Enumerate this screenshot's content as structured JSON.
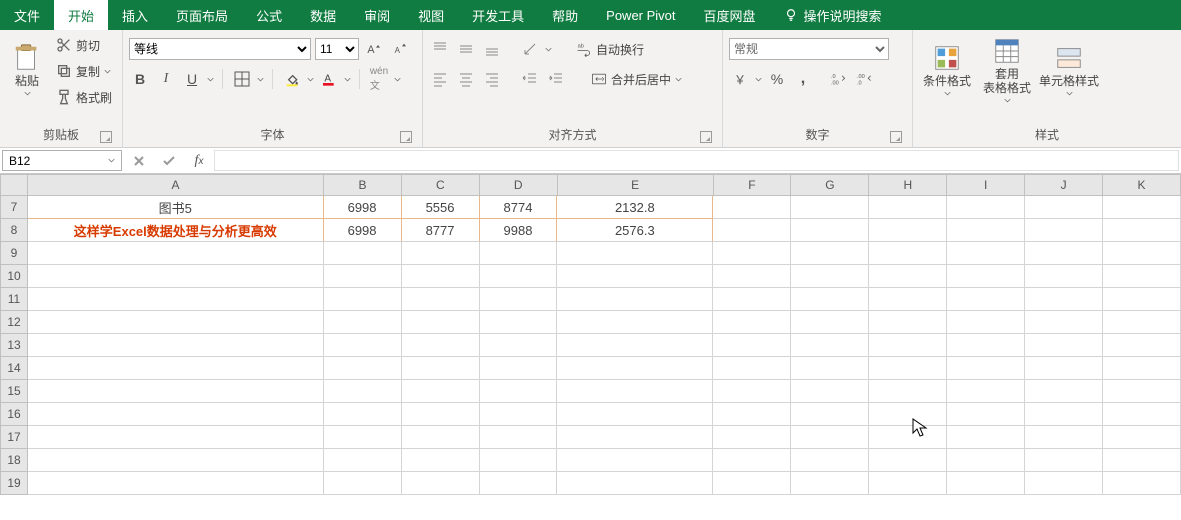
{
  "tabs": {
    "file": "文件",
    "home": "开始",
    "insert": "插入",
    "layout": "页面布局",
    "formulas": "公式",
    "data": "数据",
    "review": "审阅",
    "view": "视图",
    "dev": "开发工具",
    "help": "帮助",
    "powerpivot": "Power Pivot",
    "baidu": "百度网盘",
    "tell_me": "操作说明搜索"
  },
  "ribbon": {
    "clipboard": {
      "paste": "粘贴",
      "cut": "剪切",
      "copy": "复制",
      "painter": "格式刷",
      "label": "剪贴板"
    },
    "font": {
      "name": "等线",
      "size": "11",
      "label": "字体"
    },
    "align": {
      "wrap": "自动换行",
      "merge": "合并后居中",
      "label": "对齐方式"
    },
    "number": {
      "format": "常规",
      "label": "数字"
    },
    "styles": {
      "cond": "条件格式",
      "table": "套用\n表格格式",
      "cell": "单元格样式",
      "label": "样式"
    }
  },
  "name_box": "B12",
  "col_headers": [
    "A",
    "B",
    "C",
    "D",
    "E",
    "F",
    "G",
    "H",
    "I",
    "J",
    "K"
  ],
  "row_headers": [
    7,
    8,
    9,
    10,
    11,
    12,
    13,
    14,
    15,
    16,
    17,
    18,
    19
  ],
  "rows": [
    {
      "a": "图书5",
      "a_style": "center",
      "b": "6998",
      "c": "5556",
      "d": "8774",
      "e": "2132.8"
    },
    {
      "a": "这样学Excel数据处理与分析更高效",
      "a_style": "red",
      "b": "6998",
      "c": "8777",
      "d": "9988",
      "e": "2576.3"
    }
  ],
  "chart_data": {
    "type": "table",
    "columns": [
      "A",
      "B",
      "C",
      "D",
      "E"
    ],
    "rows": [
      [
        "图书5",
        6998,
        5556,
        8774,
        2132.8
      ],
      [
        "这样学Excel数据处理与分析更高效",
        6998,
        8777,
        9988,
        2576.3
      ]
    ]
  }
}
